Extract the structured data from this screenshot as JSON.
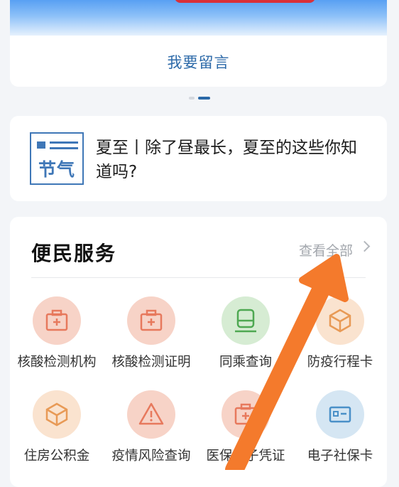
{
  "banner": {
    "leave_message_label": "我要留言",
    "carousel_active_index": 2,
    "carousel_count": 2
  },
  "article": {
    "thumb_text": "节气",
    "title": "夏至丨除了昼最长，夏至的这些你知道吗?"
  },
  "services": {
    "title": "便民服务",
    "view_all": "查看全部",
    "items": [
      {
        "label": "核酸检测机构",
        "icon": "medical-kit-icon",
        "color": "#f7d3c7"
      },
      {
        "label": "核酸检测证明",
        "icon": "medical-kit-icon",
        "color": "#f7d3c7"
      },
      {
        "label": "同乘查询",
        "icon": "train-icon",
        "color": "#d6ecd3"
      },
      {
        "label": "防疫行程卡",
        "icon": "box-icon",
        "color": "#fae3cf"
      },
      {
        "label": "住房公积金",
        "icon": "box-icon",
        "color": "#fae3cf"
      },
      {
        "label": "疫情风险查询",
        "icon": "warning-icon",
        "color": "#f7d3c7"
      },
      {
        "label": "医保电子凭证",
        "icon": "medical-kit-icon",
        "color": "#f7d3c7"
      },
      {
        "label": "电子社保卡",
        "icon": "id-card-icon",
        "color": "#d5e6f3"
      }
    ]
  },
  "colors": {
    "accent_blue": "#2a69a8",
    "arrow_orange": "#f47a2c"
  }
}
